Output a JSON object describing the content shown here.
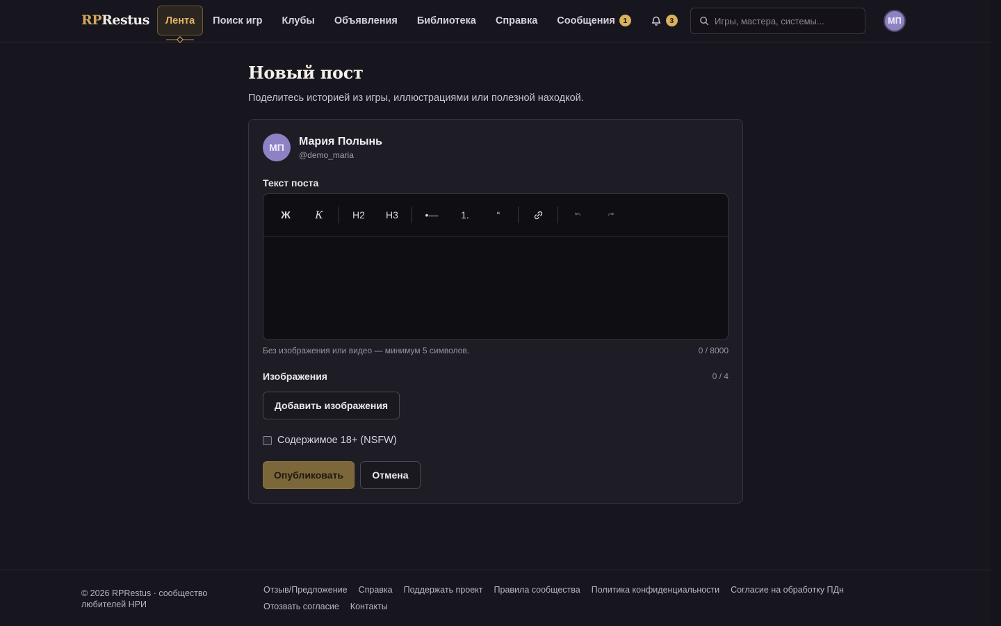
{
  "header": {
    "logo_prefix": "RP",
    "logo_suffix": "Restus",
    "nav": [
      {
        "label": "Лента",
        "active": true
      },
      {
        "label": "Поиск игр"
      },
      {
        "label": "Клубы"
      },
      {
        "label": "Объявления"
      },
      {
        "label": "Библиотека"
      },
      {
        "label": "Справка"
      },
      {
        "label": "Сообщения",
        "badge": "1"
      }
    ],
    "notifications_badge": "3",
    "search_placeholder": "Игры, мастера, системы...",
    "user_initials": "МП"
  },
  "page": {
    "title": "Новый пост",
    "subtitle": "Поделитесь историей из игры, иллюстрациями или полезной находкой."
  },
  "author": {
    "initials": "МП",
    "name": "Мария Полынь",
    "handle": "@demo_maria"
  },
  "form": {
    "text_label": "Текст поста",
    "toolbar": {
      "bold": "Ж",
      "italic": "К",
      "h2": "H2",
      "h3": "H3",
      "bullet_list": "•—",
      "ordered_list": "1.",
      "quote": "“"
    },
    "hint": "Без изображения или видео — минимум 5 символов.",
    "char_counter": "0 / 8000",
    "images_label": "Изображения",
    "images_counter": "0 / 4",
    "add_images": "Добавить изображения",
    "nsfw_label": "Содержимое 18+ (NSFW)",
    "publish": "Опубликовать",
    "cancel": "Отмена"
  },
  "footer": {
    "copyright": "© 2026 RPRestus · сообщество любителей НРИ",
    "links": [
      "Отзыв/Предложение",
      "Справка",
      "Поддержать проект",
      "Правила сообщества",
      "Политика конфиденциальности",
      "Согласие на обработку ПДн",
      "Отозвать согласие",
      "Контакты"
    ]
  },
  "colors": {
    "background": "#17151d",
    "accent": "#d9b25c",
    "avatar": "#8f82c4",
    "primary_button": "#7c673a"
  }
}
